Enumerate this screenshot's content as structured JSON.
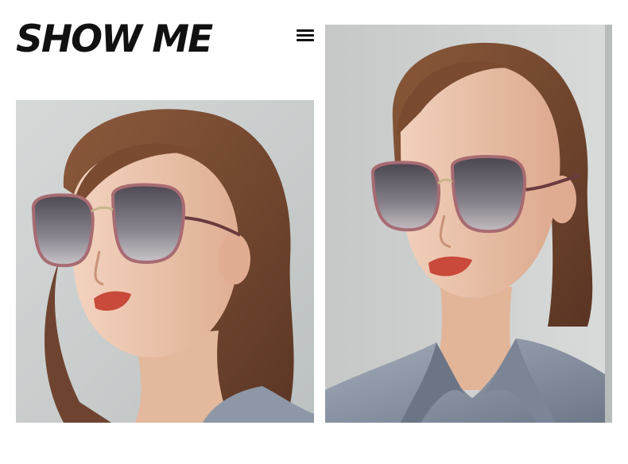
{
  "header": {
    "title": "SHOW ME",
    "menu_icon": "hamburger-menu-icon"
  },
  "photos": [
    {
      "subject": "woman-wearing-oversized-gradient-sunglasses-three-quarter-view"
    },
    {
      "subject": "woman-wearing-oversized-gradient-sunglasses-front-view"
    }
  ],
  "colors": {
    "title": "#111111",
    "background": "#ffffff",
    "photo_backdrop": "#c9cdcc",
    "hair": "#7a4a31",
    "skin": "#ecc5ae",
    "lips": "#c9493a",
    "lens": "#5d5660",
    "frame": "#a86b72",
    "blouse": "#8d97a6"
  }
}
